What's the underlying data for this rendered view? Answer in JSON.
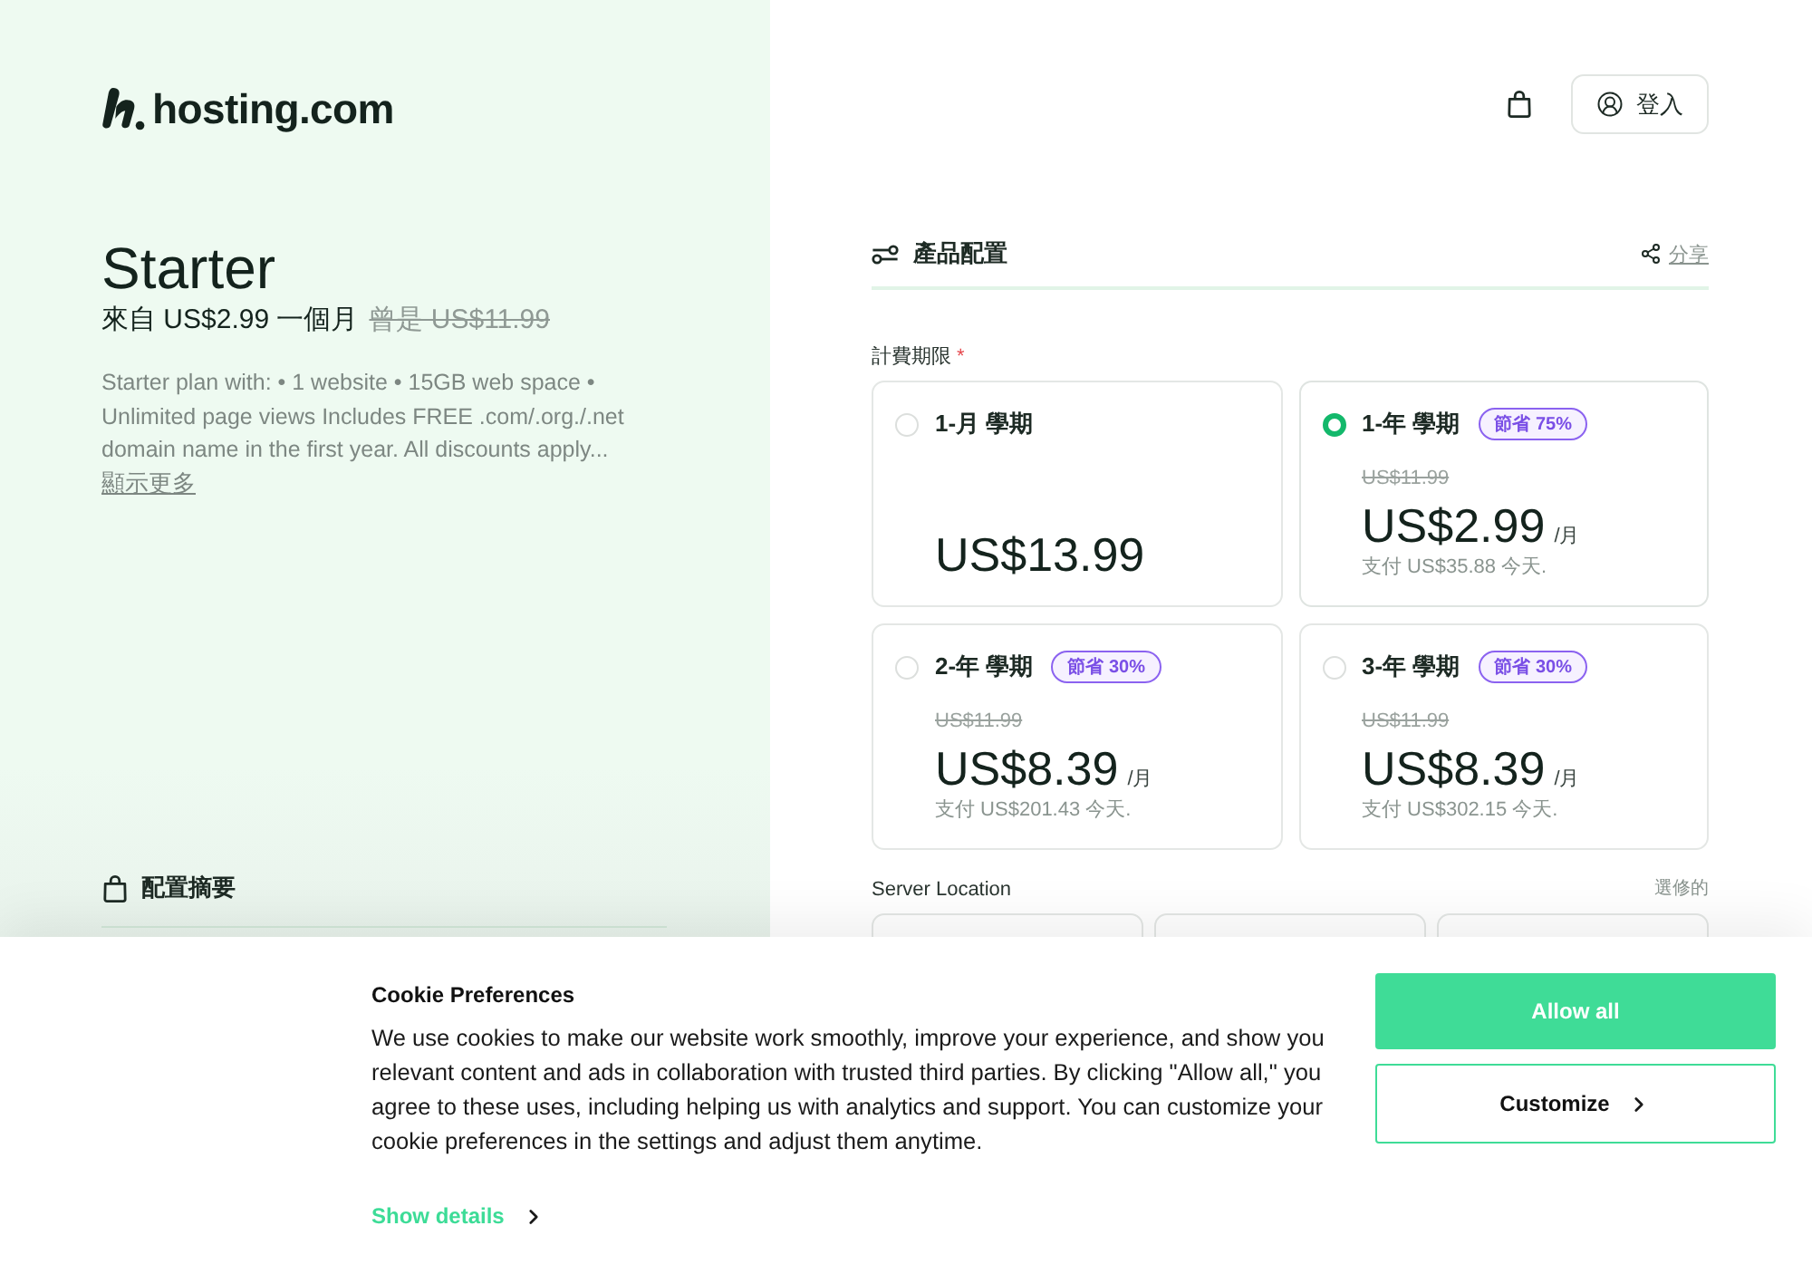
{
  "brand": {
    "name": "hosting.com"
  },
  "header": {
    "login_label": "登入"
  },
  "plan": {
    "title": "Starter",
    "price": "來自 US$2.99 一個月",
    "old_price": "曾是 US$11.99",
    "description": "Starter plan with: • 1 website • 15GB web space • Unlimited page views Includes FREE .com/.org./.net domain name in the first year. All discounts apply...",
    "show_more": "顯示更多"
  },
  "summary": {
    "title": "配置摘要"
  },
  "configuration": {
    "title": "產品配置",
    "share": "分享",
    "billing": {
      "label": "計費期限",
      "required_mark": "*",
      "options": [
        {
          "title": "1-月 學期",
          "selected": false,
          "price": "US$13.99"
        },
        {
          "title": "1-年 學期",
          "selected": true,
          "badge": "節省 75%",
          "old_price": "US$11.99",
          "price": "US$2.99",
          "unit": "/月",
          "pay_note": "支付 US$35.88 今天."
        },
        {
          "title": "2-年 學期",
          "selected": false,
          "badge": "節省 30%",
          "old_price": "US$11.99",
          "price": "US$8.39",
          "unit": "/月",
          "pay_note": "支付 US$201.43 今天."
        },
        {
          "title": "3-年 學期",
          "selected": false,
          "badge": "節省 30%",
          "old_price": "US$11.99",
          "price": "US$8.39",
          "unit": "/月",
          "pay_note": "支付 US$302.15 今天."
        }
      ]
    },
    "server_location": {
      "label": "Server Location",
      "note": "選修的"
    }
  },
  "cookie_banner": {
    "title": "Cookie Preferences",
    "text": "We use cookies to make our website work smoothly, improve your experience, and show you relevant content and ads in collaboration with trusted third parties. By clicking \"Allow all,\" you agree to these uses, including helping us with analytics and support. You can customize your cookie preferences in the settings and adjust them anytime.",
    "details_link": "Show details",
    "buttons": [
      {
        "label": "Allow all",
        "kind": "primary"
      },
      {
        "label": "Customize",
        "kind": "secondary"
      }
    ]
  }
}
